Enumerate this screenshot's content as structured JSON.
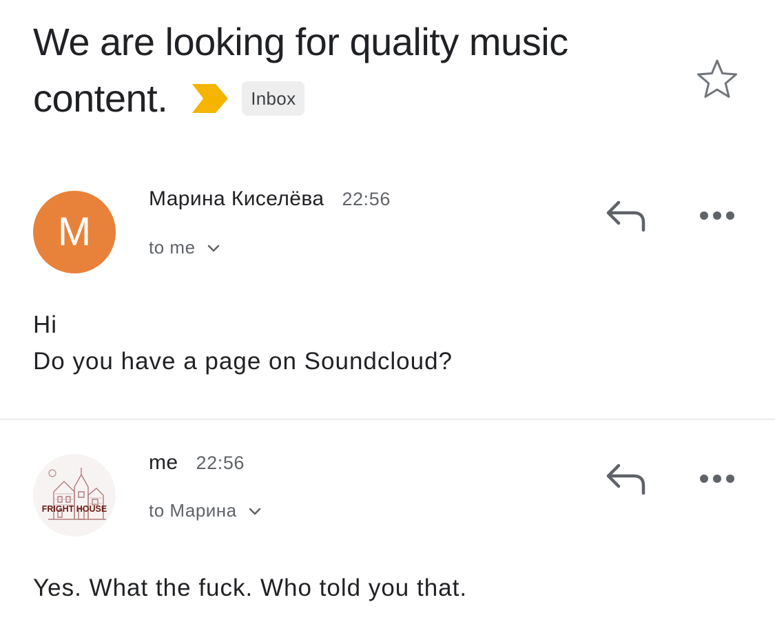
{
  "thread": {
    "subject_line1": "We are looking for quality music",
    "subject_line2": "content.",
    "label": "Inbox",
    "importance_icon": "importance-marker-icon",
    "star_icon": "star-outline-icon",
    "colors": {
      "importance": "#f4b400",
      "avatar_m": "#e8823a"
    }
  },
  "messages": [
    {
      "avatar_letter": "M",
      "sender": "Марина Киселёва",
      "time": "22:56",
      "recipient": "to me",
      "body_lines": [
        "Hi",
        "Do you have a page on Soundcloud?"
      ],
      "reply_icon": "reply-icon",
      "more_icon": "more-horizontal-icon"
    },
    {
      "avatar_text": "FRIGHT HOUSE",
      "sender": "me",
      "time": "22:56",
      "recipient": "to Марина",
      "body_lines": [
        "Yes. What the fuck. Who told you that."
      ],
      "reply_icon": "reply-icon",
      "more_icon": "more-horizontal-icon"
    }
  ]
}
